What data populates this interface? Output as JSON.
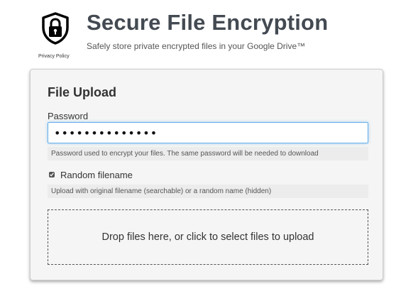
{
  "header": {
    "title": "Secure File Encryption",
    "subtitle": "Safely store private encrypted files in your Google Drive™",
    "privacy_link": "Privacy Policy",
    "logo_icon": "lock-shield-icon"
  },
  "upload": {
    "title": "File Upload",
    "password_label": "Password",
    "password_value": "••••••••••••••",
    "password_help": "Password used to encrypt your files. The same password will be needed to download",
    "random_filename_label": "Random filename",
    "random_filename_checked": true,
    "random_filename_help": "Upload with original filename (searchable) or a random name (hidden)",
    "dropzone_text": "Drop files here, or click to select files to upload"
  },
  "colors": {
    "title": "#444a52",
    "focus_border": "#66afe9",
    "panel_bg": "#f5f5f5",
    "help_bg": "#ececec"
  }
}
